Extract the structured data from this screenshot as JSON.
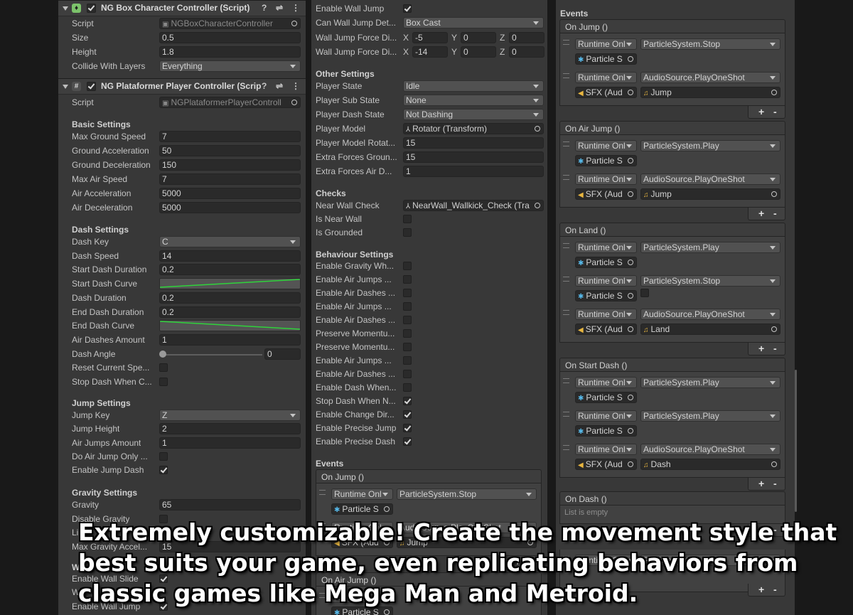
{
  "col1": {
    "box_header": {
      "title": "NG Box Character Controller (Script)"
    },
    "box_rows": [
      {
        "label": "Script",
        "value": "NGBoxCharacterController",
        "kind": "script"
      },
      {
        "label": "Size",
        "value": "0.5",
        "kind": "text"
      },
      {
        "label": "Height",
        "value": "1.8",
        "kind": "text"
      },
      {
        "label": "Collide With Layers",
        "value": "Everything",
        "kind": "dropdown"
      }
    ],
    "player_header": {
      "title": "NG Plataformer Player Controller (Scrip"
    },
    "player_script": {
      "label": "Script",
      "value": "NGPlataformerPlayerControll"
    },
    "basic_title": "Basic Settings",
    "basic_rows": [
      {
        "label": "Max Ground Speed",
        "value": "7"
      },
      {
        "label": "Ground Acceleration",
        "value": "50"
      },
      {
        "label": "Ground Deceleration",
        "value": "150"
      },
      {
        "label": "Max Air Speed",
        "value": "7"
      },
      {
        "label": "Air Acceleration",
        "value": "5000"
      },
      {
        "label": "Air Deceleration",
        "value": "5000"
      }
    ],
    "dash_title": "Dash Settings",
    "dash_rows": [
      {
        "label": "Dash Key",
        "value": "C",
        "kind": "dropdown"
      },
      {
        "label": "Dash Speed",
        "value": "14",
        "kind": "text"
      },
      {
        "label": "Start Dash Duration",
        "value": "0.2",
        "kind": "text"
      },
      {
        "label": "Start Dash Curve",
        "value": "",
        "kind": "curve-up"
      },
      {
        "label": "Dash Duration",
        "value": "0.2",
        "kind": "text"
      },
      {
        "label": "End Dash Duration",
        "value": "0.2",
        "kind": "text"
      },
      {
        "label": "End Dash Curve",
        "value": "",
        "kind": "curve-down"
      },
      {
        "label": "Air Dashes Amount",
        "value": "1",
        "kind": "text"
      },
      {
        "label": "Dash Angle",
        "value": "0",
        "kind": "slider"
      },
      {
        "label": "Reset Current Spe...",
        "value": "",
        "kind": "check-off"
      },
      {
        "label": "Stop Dash When C...",
        "value": "",
        "kind": "check-off"
      }
    ],
    "jump_title": "Jump Settings",
    "jump_rows": [
      {
        "label": "Jump Key",
        "value": "Z",
        "kind": "dropdown"
      },
      {
        "label": "Jump Height",
        "value": "2",
        "kind": "text"
      },
      {
        "label": "Air Jumps Amount",
        "value": "1",
        "kind": "text"
      },
      {
        "label": "Do Air Jump Only ...",
        "value": "",
        "kind": "check-off"
      },
      {
        "label": "Enable Jump Dash",
        "value": "",
        "kind": "check-on"
      }
    ],
    "gravity_title": "Gravity Settings",
    "gravity_rows": [
      {
        "label": "Gravity",
        "value": "65",
        "kind": "text"
      },
      {
        "label": "Disable Gravity",
        "value": "",
        "kind": "check-off"
      },
      {
        "label": "Li",
        "value": "",
        "kind": "none"
      },
      {
        "label": "Max Gravity Accel...",
        "value": "15",
        "kind": "text"
      }
    ],
    "wall_title": "W",
    "wall_rows": [
      {
        "label": "Enable Wall Slide",
        "value": "",
        "kind": "check-on"
      },
      {
        "label": "W",
        "value": "",
        "kind": "none"
      },
      {
        "label": "Enable Wall Jump",
        "value": "",
        "kind": "check-on"
      }
    ]
  },
  "col2": {
    "top_rows": [
      {
        "label": "Enable Wall Jump",
        "kind": "check-on"
      },
      {
        "label": "Can Wall Jump Det...",
        "kind": "dropdown",
        "value": "Box Cast"
      }
    ],
    "vec_rows": [
      {
        "label": "Wall Jump Force Di...",
        "x": "-5",
        "y": "0",
        "z": "0"
      },
      {
        "label": "Wall Jump Force Di...",
        "x": "-14",
        "y": "0",
        "z": "0"
      }
    ],
    "axis": {
      "x": "X",
      "y": "Y",
      "z": "Z"
    },
    "other_title": "Other Settings",
    "other_rows": [
      {
        "label": "Player State",
        "value": "Idle",
        "kind": "dropdown"
      },
      {
        "label": "Player Sub State",
        "value": "None",
        "kind": "dropdown"
      },
      {
        "label": "Player Dash State",
        "value": "Not Dashing",
        "kind": "dropdown"
      },
      {
        "label": "Player Model",
        "value": "Rotator (Transform)",
        "kind": "object"
      },
      {
        "label": "Player Model Rotat...",
        "value": "15",
        "kind": "text"
      },
      {
        "label": "Extra Forces Groun...",
        "value": "15",
        "kind": "text"
      },
      {
        "label": "Extra Forces Air D...",
        "value": "1",
        "kind": "text"
      }
    ],
    "checks_title": "Checks",
    "checks_rows": [
      {
        "label": "Near Wall Check",
        "value": "NearWall_Wallkick_Check (Tra",
        "kind": "object"
      },
      {
        "label": "Is Near Wall",
        "value": "",
        "kind": "check-off"
      },
      {
        "label": "Is Grounded",
        "value": "",
        "kind": "check-off"
      }
    ],
    "behaviour_title": "Behaviour Settings",
    "behaviour_rows": [
      {
        "label": "Enable Gravity Wh...",
        "kind": "check-off"
      },
      {
        "label": "Enable Air Jumps ...",
        "kind": "check-off"
      },
      {
        "label": "Enable Air Dashes ...",
        "kind": "check-off"
      },
      {
        "label": "Enable Air Jumps ...",
        "kind": "check-off"
      },
      {
        "label": "Enable Air Dashes ...",
        "kind": "check-off"
      },
      {
        "label": "Preserve Momentu...",
        "kind": "check-off"
      },
      {
        "label": "Preserve Momentu...",
        "kind": "check-off"
      },
      {
        "label": "Enable Air Jumps ...",
        "kind": "check-off"
      },
      {
        "label": "Enable Air Dashes ...",
        "kind": "check-off"
      },
      {
        "label": "Enable Dash When...",
        "kind": "check-off"
      },
      {
        "label": "Stop Dash When N...",
        "kind": "check-on"
      },
      {
        "label": "Enable Change Dir...",
        "kind": "check-on"
      },
      {
        "label": "Enable Precise Jump",
        "kind": "check-on"
      },
      {
        "label": "Enable Precise Dash",
        "kind": "check-on"
      }
    ],
    "events_title": "Events",
    "on_jump": {
      "title": "On Jump ()",
      "entries": [
        {
          "runtime": "Runtime Onl",
          "func": "ParticleSystem.Stop",
          "target": "Particle S",
          "target_icon": "blue",
          "arg": ""
        },
        {
          "runtime": "Runtime Onl",
          "func": "AudioSource.PlayOneShot",
          "target": "SFX (Aud",
          "target_icon": "gold",
          "arg": "Jump"
        }
      ]
    },
    "on_air_jump": {
      "title": "On Air Jump ()",
      "entries": [
        {
          "runtime": "Runtime Onl",
          "func": "",
          "target": "Particle S",
          "target_icon": "blue",
          "arg": ""
        }
      ]
    }
  },
  "col3": {
    "events_title": "Events",
    "groups": [
      {
        "title": "On Jump ()",
        "entries": [
          {
            "runtime": "Runtime Onl",
            "func": "ParticleSystem.Stop",
            "target": "Particle S",
            "target_icon": "blue",
            "arg": ""
          },
          {
            "runtime": "Runtime Onl",
            "func": "AudioSource.PlayOneShot",
            "target": "SFX (Aud",
            "target_icon": "gold",
            "arg": "Jump"
          }
        ]
      },
      {
        "title": "On Air Jump ()",
        "entries": [
          {
            "runtime": "Runtime Onl",
            "func": "ParticleSystem.Play",
            "target": "Particle S",
            "target_icon": "blue",
            "arg": ""
          },
          {
            "runtime": "Runtime Onl",
            "func": "AudioSource.PlayOneShot",
            "target": "SFX (Aud",
            "target_icon": "gold",
            "arg": "Jump"
          }
        ]
      },
      {
        "title": "On Land ()",
        "entries": [
          {
            "runtime": "Runtime Onl",
            "func": "ParticleSystem.Play",
            "target": "Particle S",
            "target_icon": "blue",
            "arg": ""
          },
          {
            "runtime": "Runtime Onl",
            "func": "ParticleSystem.Stop",
            "target": "Particle S",
            "target_icon": "blue",
            "arg": "check"
          },
          {
            "runtime": "Runtime Onl",
            "func": "AudioSource.PlayOneShot",
            "target": "SFX (Aud",
            "target_icon": "gold",
            "arg": "Land"
          }
        ]
      },
      {
        "title": "On Start Dash ()",
        "entries": [
          {
            "runtime": "Runtime Onl",
            "func": "ParticleSystem.Play",
            "target": "Particle S",
            "target_icon": "blue",
            "arg": ""
          },
          {
            "runtime": "Runtime Onl",
            "func": "ParticleSystem.Play",
            "target": "Particle S",
            "target_icon": "blue",
            "arg": ""
          },
          {
            "runtime": "Runtime Onl",
            "func": "AudioSource.PlayOneShot",
            "target": "SFX (Aud",
            "target_icon": "gold",
            "arg": "Dash"
          }
        ]
      }
    ],
    "on_dash": {
      "title": "On Dash ()",
      "empty": "List is empty"
    },
    "last_entry": {
      "runtime": "Runtime O",
      "func": "ParticleSystem.Stop"
    }
  },
  "buttons": {
    "add": "+",
    "remove": "-"
  },
  "caption": "Extremely customizable! Create the movement style that best suits your game, even replicating behaviors from classic games like Mega Man and Metroid."
}
